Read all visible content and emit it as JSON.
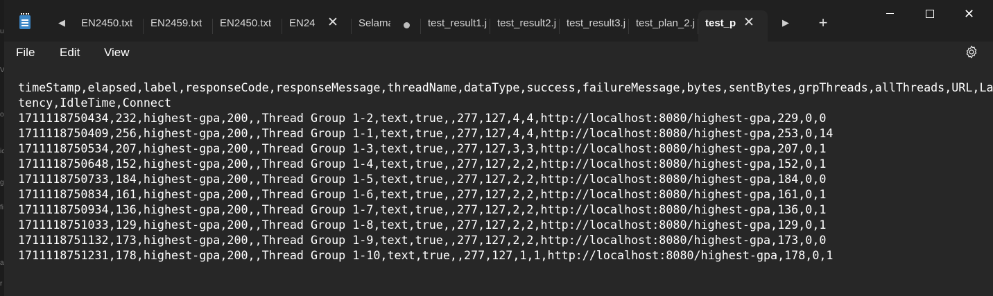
{
  "background_fragments": [
    "u",
    "V",
    "o",
    "ic",
    "g",
    "fi",
    "a",
    "r"
  ],
  "tabs": [
    {
      "label": "EN2450.txt"
    },
    {
      "label": "EN2459.txt"
    },
    {
      "label": "EN2450.txt"
    },
    {
      "label": "EN24"
    },
    {
      "label": "Selama"
    },
    {
      "label": "test_result1.j"
    },
    {
      "label": "test_result2.j"
    },
    {
      "label": "test_result3.j"
    },
    {
      "label": "test_plan_2.j"
    },
    {
      "label": "test_p"
    }
  ],
  "icons": {
    "app": "notepad-icon",
    "scroll_left": "triangle-left-icon",
    "scroll_right": "triangle-right-icon",
    "close": "close-icon",
    "unsaved": "unsaved-dot-icon",
    "new_tab": "plus-icon",
    "settings": "gear-icon"
  },
  "window_controls": {
    "minimize": "",
    "maximize": "",
    "close": "✕"
  },
  "menu": {
    "file": "File",
    "edit": "Edit",
    "view": "View"
  },
  "editor": {
    "lines": [
      "timeStamp,elapsed,label,responseCode,responseMessage,threadName,dataType,success,failureMessage,bytes,sentBytes,grpThreads,allThreads,URL,La",
      "tency,IdleTime,Connect",
      "1711118750434,232,highest-gpa,200,,Thread Group 1-2,text,true,,277,127,4,4,http://localhost:8080/highest-gpa,229,0,0",
      "1711118750409,256,highest-gpa,200,,Thread Group 1-1,text,true,,277,127,4,4,http://localhost:8080/highest-gpa,253,0,14",
      "1711118750534,207,highest-gpa,200,,Thread Group 1-3,text,true,,277,127,3,3,http://localhost:8080/highest-gpa,207,0,1",
      "1711118750648,152,highest-gpa,200,,Thread Group 1-4,text,true,,277,127,2,2,http://localhost:8080/highest-gpa,152,0,1",
      "1711118750733,184,highest-gpa,200,,Thread Group 1-5,text,true,,277,127,2,2,http://localhost:8080/highest-gpa,184,0,0",
      "1711118750834,161,highest-gpa,200,,Thread Group 1-6,text,true,,277,127,2,2,http://localhost:8080/highest-gpa,161,0,1",
      "1711118750934,136,highest-gpa,200,,Thread Group 1-7,text,true,,277,127,2,2,http://localhost:8080/highest-gpa,136,0,1",
      "1711118751033,129,highest-gpa,200,,Thread Group 1-8,text,true,,277,127,2,2,http://localhost:8080/highest-gpa,129,0,1",
      "1711118751132,173,highest-gpa,200,,Thread Group 1-9,text,true,,277,127,2,2,http://localhost:8080/highest-gpa,173,0,0",
      "1711118751231,178,highest-gpa,200,,Thread Group 1-10,text,true,,277,127,1,1,http://localhost:8080/highest-gpa,178,0,1"
    ]
  },
  "colors": {
    "titlebar": "#202020",
    "editor_bg": "#272727",
    "text": "#ffffff",
    "tab_text": "#d6d6d6",
    "app_icon": "#3b86c6"
  }
}
